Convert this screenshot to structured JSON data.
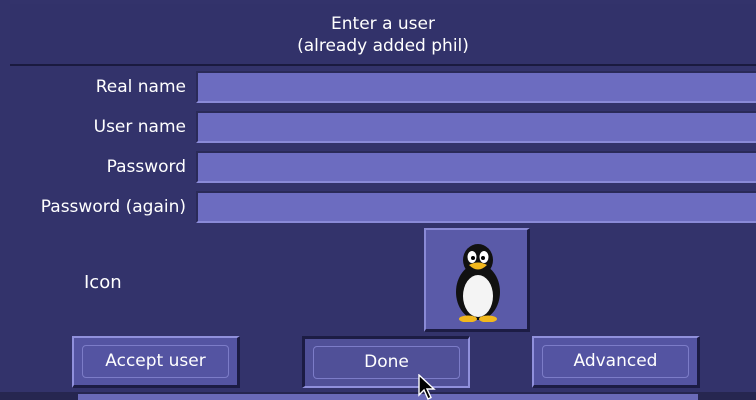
{
  "dialog": {
    "title": "Enter a user",
    "subtitle": "(already added phil)"
  },
  "form": {
    "fields": [
      {
        "label": "Real name",
        "value": ""
      },
      {
        "label": "User name",
        "value": ""
      },
      {
        "label": "Password",
        "value": ""
      },
      {
        "label": "Password (again)",
        "value": ""
      }
    ],
    "icon_label": "Icon",
    "icon_name": "penguin-icon"
  },
  "buttons": {
    "accept": "Accept user",
    "done": "Done",
    "advanced": "Advanced"
  },
  "colors": {
    "background": "#33336b",
    "field": "#6c6cc0",
    "button": "#5454a2"
  }
}
